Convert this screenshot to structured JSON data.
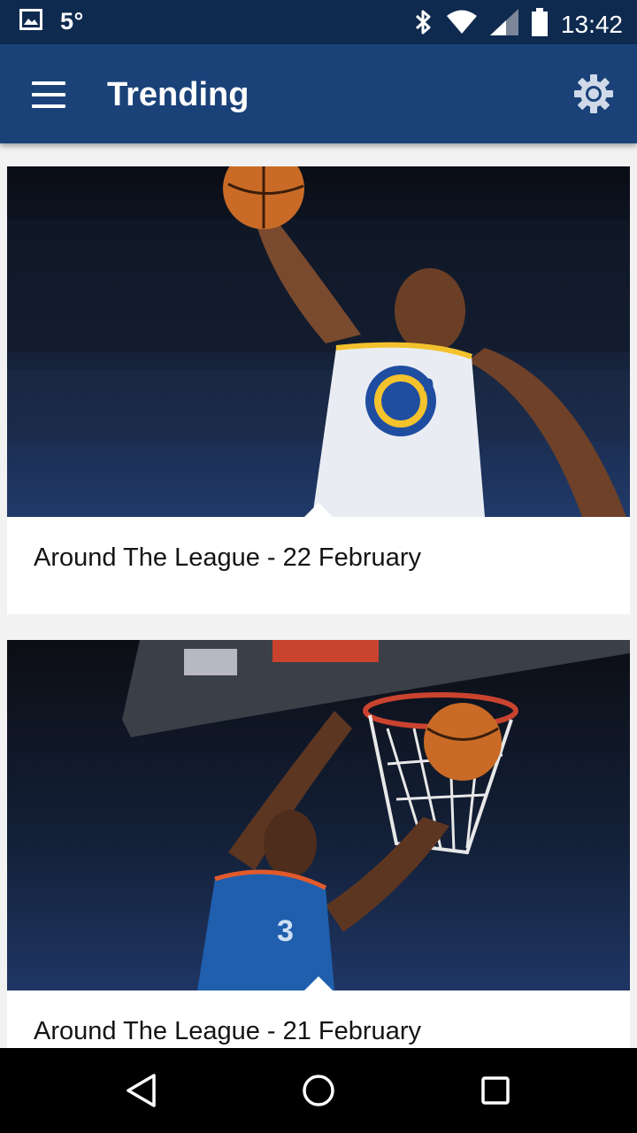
{
  "status_bar": {
    "temperature": "5°",
    "time": "13:42",
    "icons": [
      "image-icon",
      "bluetooth-icon",
      "wifi-icon",
      "signal-icon",
      "battery-icon"
    ]
  },
  "app_bar": {
    "title": "Trending",
    "menu_icon": "hamburger-menu-icon",
    "settings_icon": "gear-icon"
  },
  "feed": {
    "cards": [
      {
        "title": "Around The League - 22 February"
      },
      {
        "title": "Around The League - 21 February"
      }
    ]
  },
  "nav_bar": {
    "icons": [
      "back-icon",
      "home-icon",
      "recents-icon"
    ]
  },
  "colors": {
    "status_bar": "#0f2a4f",
    "app_bar": "#1a4279",
    "background": "#f2f2f2"
  }
}
